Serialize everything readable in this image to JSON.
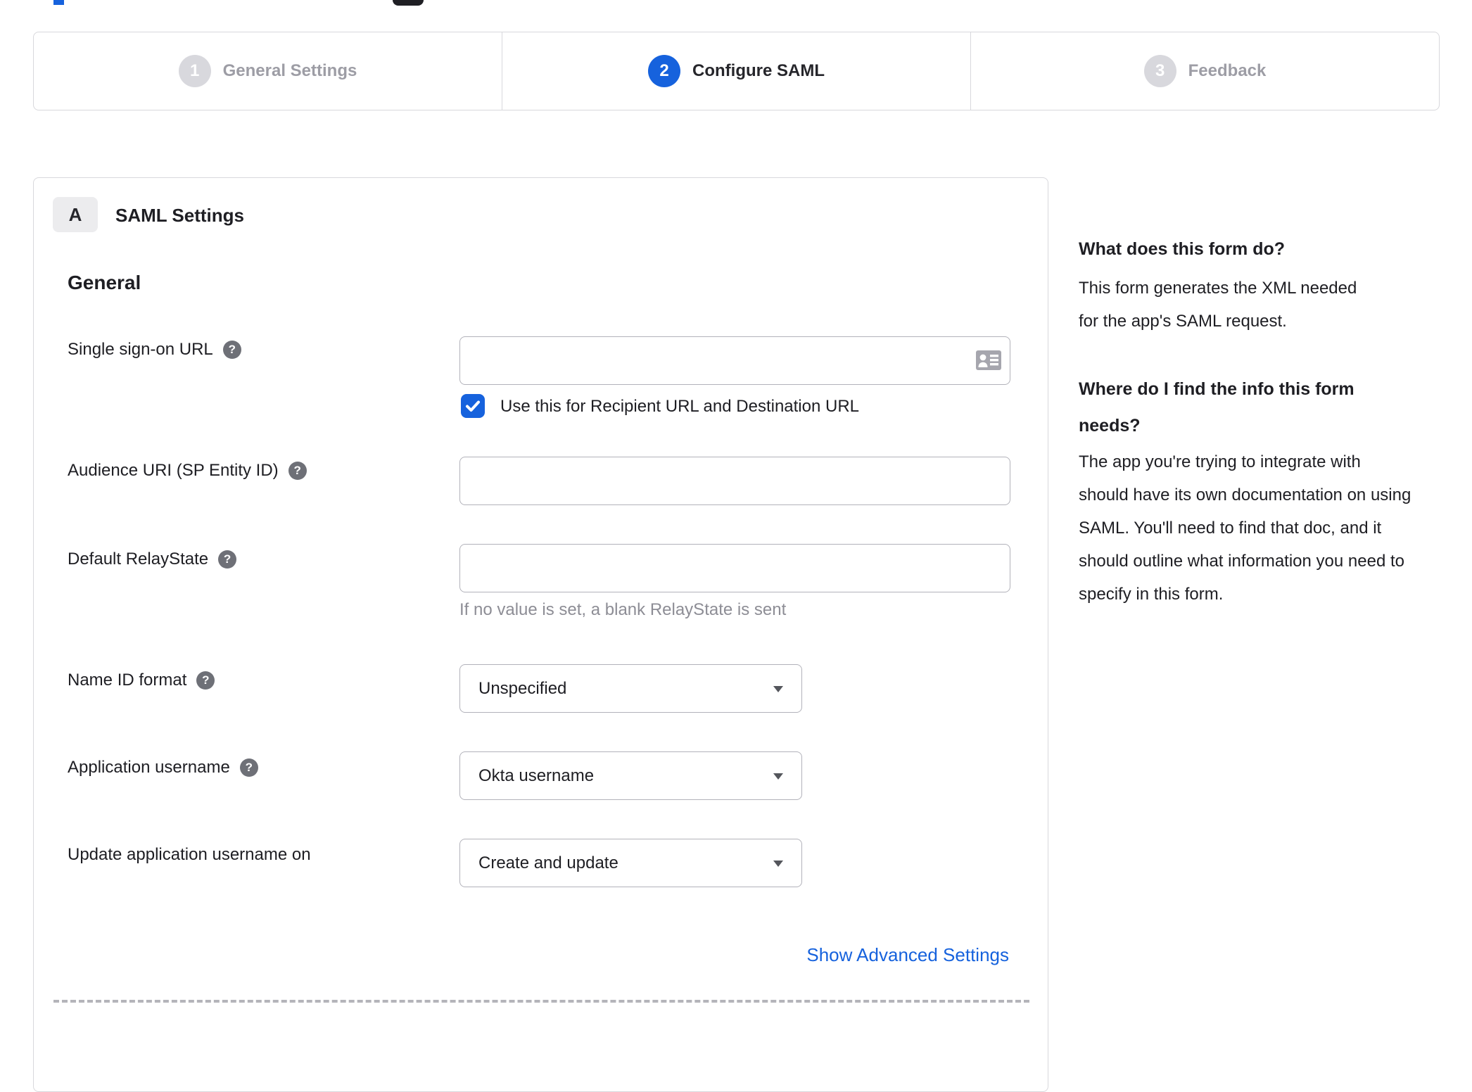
{
  "colors": {
    "accent_blue": "#1662dd",
    "inactive_gray": "#d8d8dd",
    "text_dark": "#1e1e23",
    "hint_gray": "#8d8d95"
  },
  "glyphs": {
    "help": "?"
  },
  "stepper": {
    "steps": [
      {
        "number": "1",
        "label": "General Settings",
        "state": "inactive"
      },
      {
        "number": "2",
        "label": "Configure SAML",
        "state": "active"
      },
      {
        "number": "3",
        "label": "Feedback",
        "state": "inactive"
      }
    ]
  },
  "panel": {
    "badge": "A",
    "title": "SAML Settings",
    "section_heading": "General",
    "checkbox_label": "Use this for Recipient URL and Destination URL",
    "checkbox_checked": true,
    "advanced_link": "Show Advanced Settings"
  },
  "fields": {
    "sso": {
      "label": "Single sign-on URL",
      "value": ""
    },
    "audience": {
      "label": "Audience URI (SP Entity ID)",
      "value": ""
    },
    "relaystate": {
      "label": "Default RelayState",
      "value": "",
      "hint": "If no value is set, a blank RelayState is sent"
    },
    "nameid": {
      "label": "Name ID format",
      "value": "Unspecified"
    },
    "appusername": {
      "label": "Application username",
      "value": "Okta username"
    },
    "updateusername": {
      "label": "Update application username on",
      "value": "Create and update"
    }
  },
  "sidebar": {
    "q1": "What does this form do?",
    "a1": "This form generates the XML needed for the app's SAML request.",
    "q2": "Where do I find the info this form needs?",
    "a2": "The app you're trying to integrate with should have its own documentation on using SAML. You'll need to find that doc, and it should outline what information you need to specify in this form."
  }
}
